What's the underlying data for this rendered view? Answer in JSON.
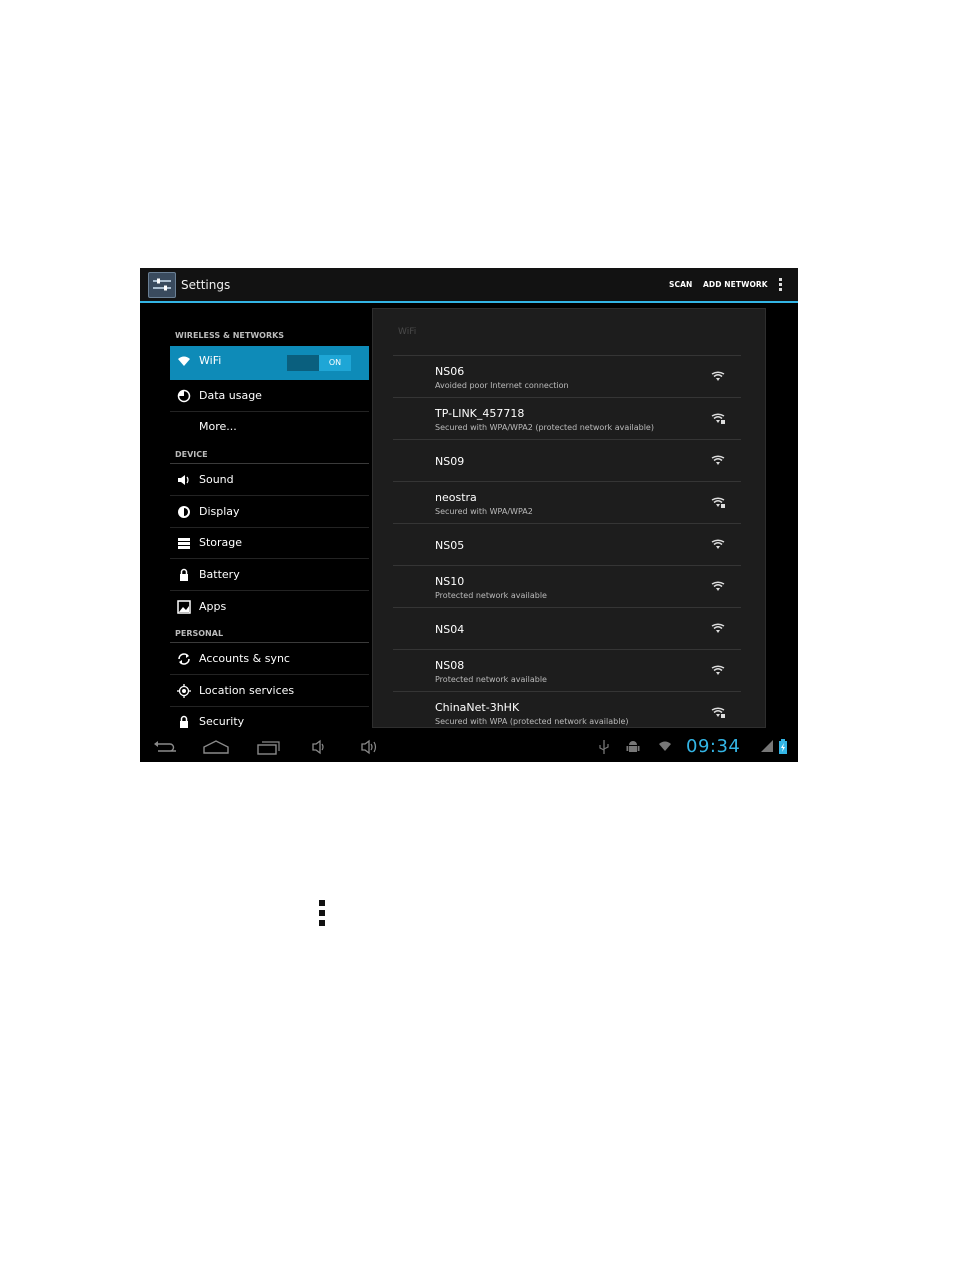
{
  "window": {
    "title": "Settings"
  },
  "action_bar": {
    "scan_label": "SCAN",
    "add_network_label": "ADD NETWORK"
  },
  "sidebar": {
    "section_wireless": "WIRELESS & NETWORKS",
    "section_device": "DEVICE",
    "section_personal": "PERSONAL",
    "items": [
      {
        "label": "WiFi",
        "icon": "wifi-icon"
      },
      {
        "label": "Data usage",
        "icon": "data-usage-icon"
      },
      {
        "label": "More...",
        "icon": ""
      },
      {
        "label": "Sound",
        "icon": "speaker-icon"
      },
      {
        "label": "Display",
        "icon": "brightness-icon"
      },
      {
        "label": "Storage",
        "icon": "storage-icon"
      },
      {
        "label": "Battery",
        "icon": "battery-icon"
      },
      {
        "label": "Apps",
        "icon": "apps-icon"
      },
      {
        "label": "Accounts & sync",
        "icon": "sync-icon"
      },
      {
        "label": "Location services",
        "icon": "location-icon"
      },
      {
        "label": "Security",
        "icon": "lock-icon"
      }
    ],
    "wifi_toggle": "ON"
  },
  "wifi_panel": {
    "title": "WiFi",
    "networks": [
      {
        "name": "NS06",
        "status": "Avoided poor Internet connection",
        "secured": false
      },
      {
        "name": "TP-LINK_457718",
        "status": "Secured with WPA/WPA2 (protected network available)",
        "secured": true
      },
      {
        "name": "NS09",
        "status": "",
        "secured": false
      },
      {
        "name": "neostra",
        "status": "Secured with WPA/WPA2",
        "secured": true
      },
      {
        "name": "NS05",
        "status": "",
        "secured": false
      },
      {
        "name": "NS10",
        "status": "Protected network available",
        "secured": false
      },
      {
        "name": "NS04",
        "status": "",
        "secured": false
      },
      {
        "name": "NS08",
        "status": "Protected network available",
        "secured": false
      },
      {
        "name": "ChinaNet-3hHK",
        "status": "Secured with WPA (protected network available)",
        "secured": true
      }
    ]
  },
  "status_bar": {
    "time": "09:34"
  },
  "colors": {
    "accent": "#33b5e5",
    "selected": "#0e8bb8",
    "background": "#000000"
  }
}
